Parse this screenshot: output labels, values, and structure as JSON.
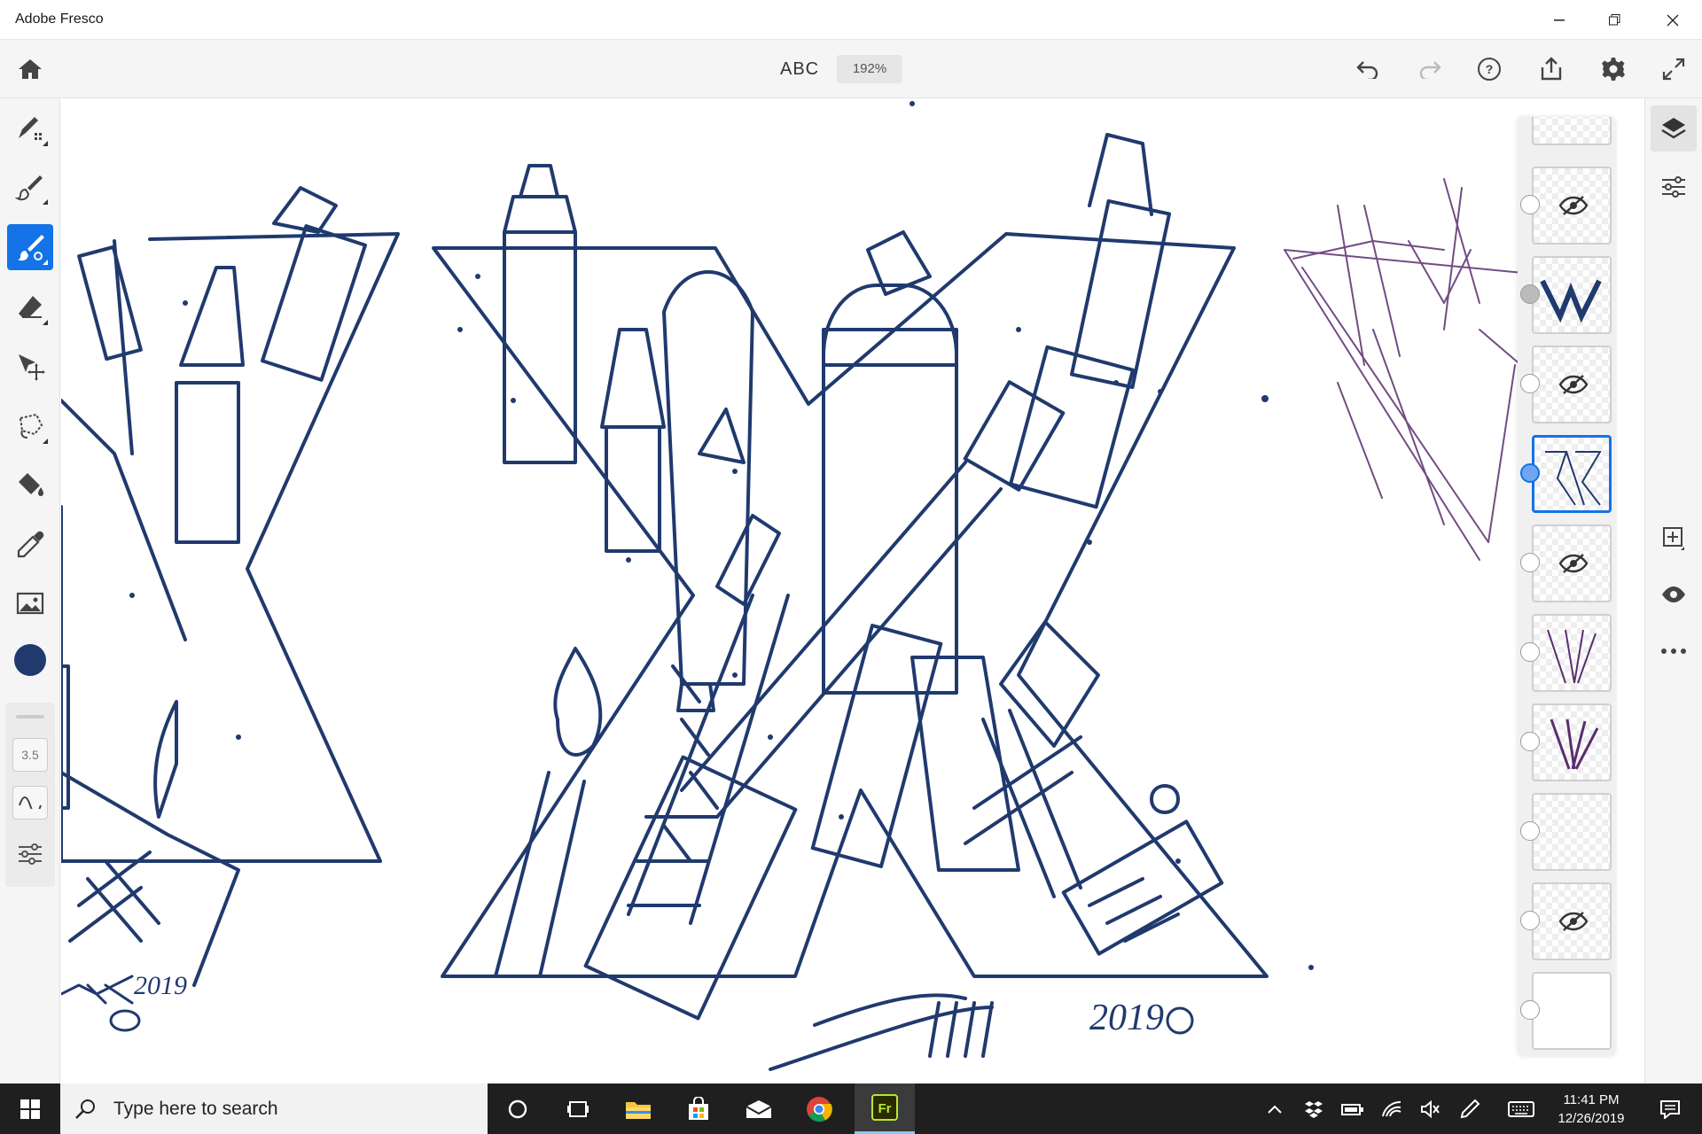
{
  "window": {
    "title": "Adobe Fresco"
  },
  "appbar": {
    "doc_title": "ABC",
    "zoom": "192%"
  },
  "left_toolbar": {
    "tools": [
      "pixel-brush",
      "live-brush",
      "vector-brush",
      "eraser",
      "move-transform",
      "lasso",
      "fill",
      "eyedropper",
      "place-image"
    ],
    "active_tool": "vector-brush",
    "color": "#203a6e",
    "brush_size": "3.5"
  },
  "canvas": {
    "signature_main": "2019",
    "signature_small": "2019"
  },
  "layers": {
    "count": 11,
    "selected_index": 4,
    "hidden_indices": [
      1,
      3,
      5,
      9
    ]
  },
  "taskbar": {
    "search_placeholder": "Type here to search",
    "time": "11:41 PM",
    "date": "12/26/2019"
  },
  "colors": {
    "accent": "#1473e6",
    "ink": "#203a6e",
    "sketch": "#5a2d6e"
  }
}
